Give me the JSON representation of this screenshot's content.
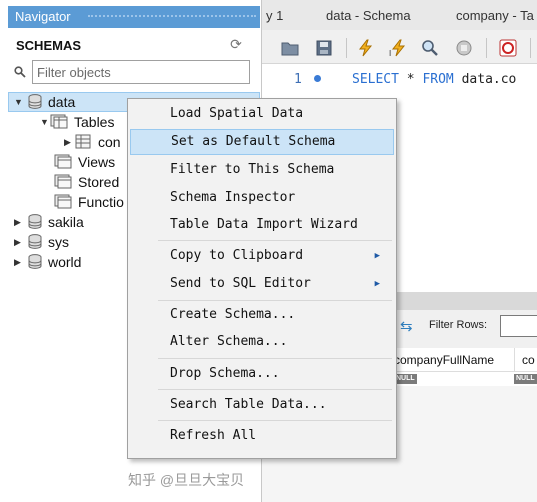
{
  "navigator": {
    "title": "Navigator",
    "schemas_title": "SCHEMAS",
    "filter_placeholder": "Filter objects",
    "tree": {
      "data": "data",
      "tables": "Tables",
      "company_partial": "con",
      "views": "Views",
      "stored": "Stored",
      "functions": "Functio",
      "sakila": "sakila",
      "sys": "sys",
      "world": "world"
    }
  },
  "editor": {
    "tabs": [
      "y 1",
      "data - Schema",
      "company - Ta"
    ],
    "line_number": "1",
    "code": {
      "kw1": "SELECT",
      "star": "*",
      "kw2": "FROM",
      "rest": "data.co"
    },
    "filter_rows_label": "Filter Rows:",
    "columns": [
      "companyFullName",
      "co"
    ],
    "null_label": "NULL"
  },
  "context_menu": {
    "items": [
      "Load Spatial Data",
      "Set as Default Schema",
      "Filter to This Schema",
      "Schema Inspector",
      "Table Data Import Wizard",
      "Copy to Clipboard",
      "Send to SQL Editor",
      "Create Schema...",
      "Alter Schema...",
      "Drop Schema...",
      "Search Table Data...",
      "Refresh All"
    ]
  },
  "watermark": "知乎 @旦旦大宝贝",
  "colors": {
    "accent": "#5b9bd5",
    "highlight": "#cce4f7"
  }
}
